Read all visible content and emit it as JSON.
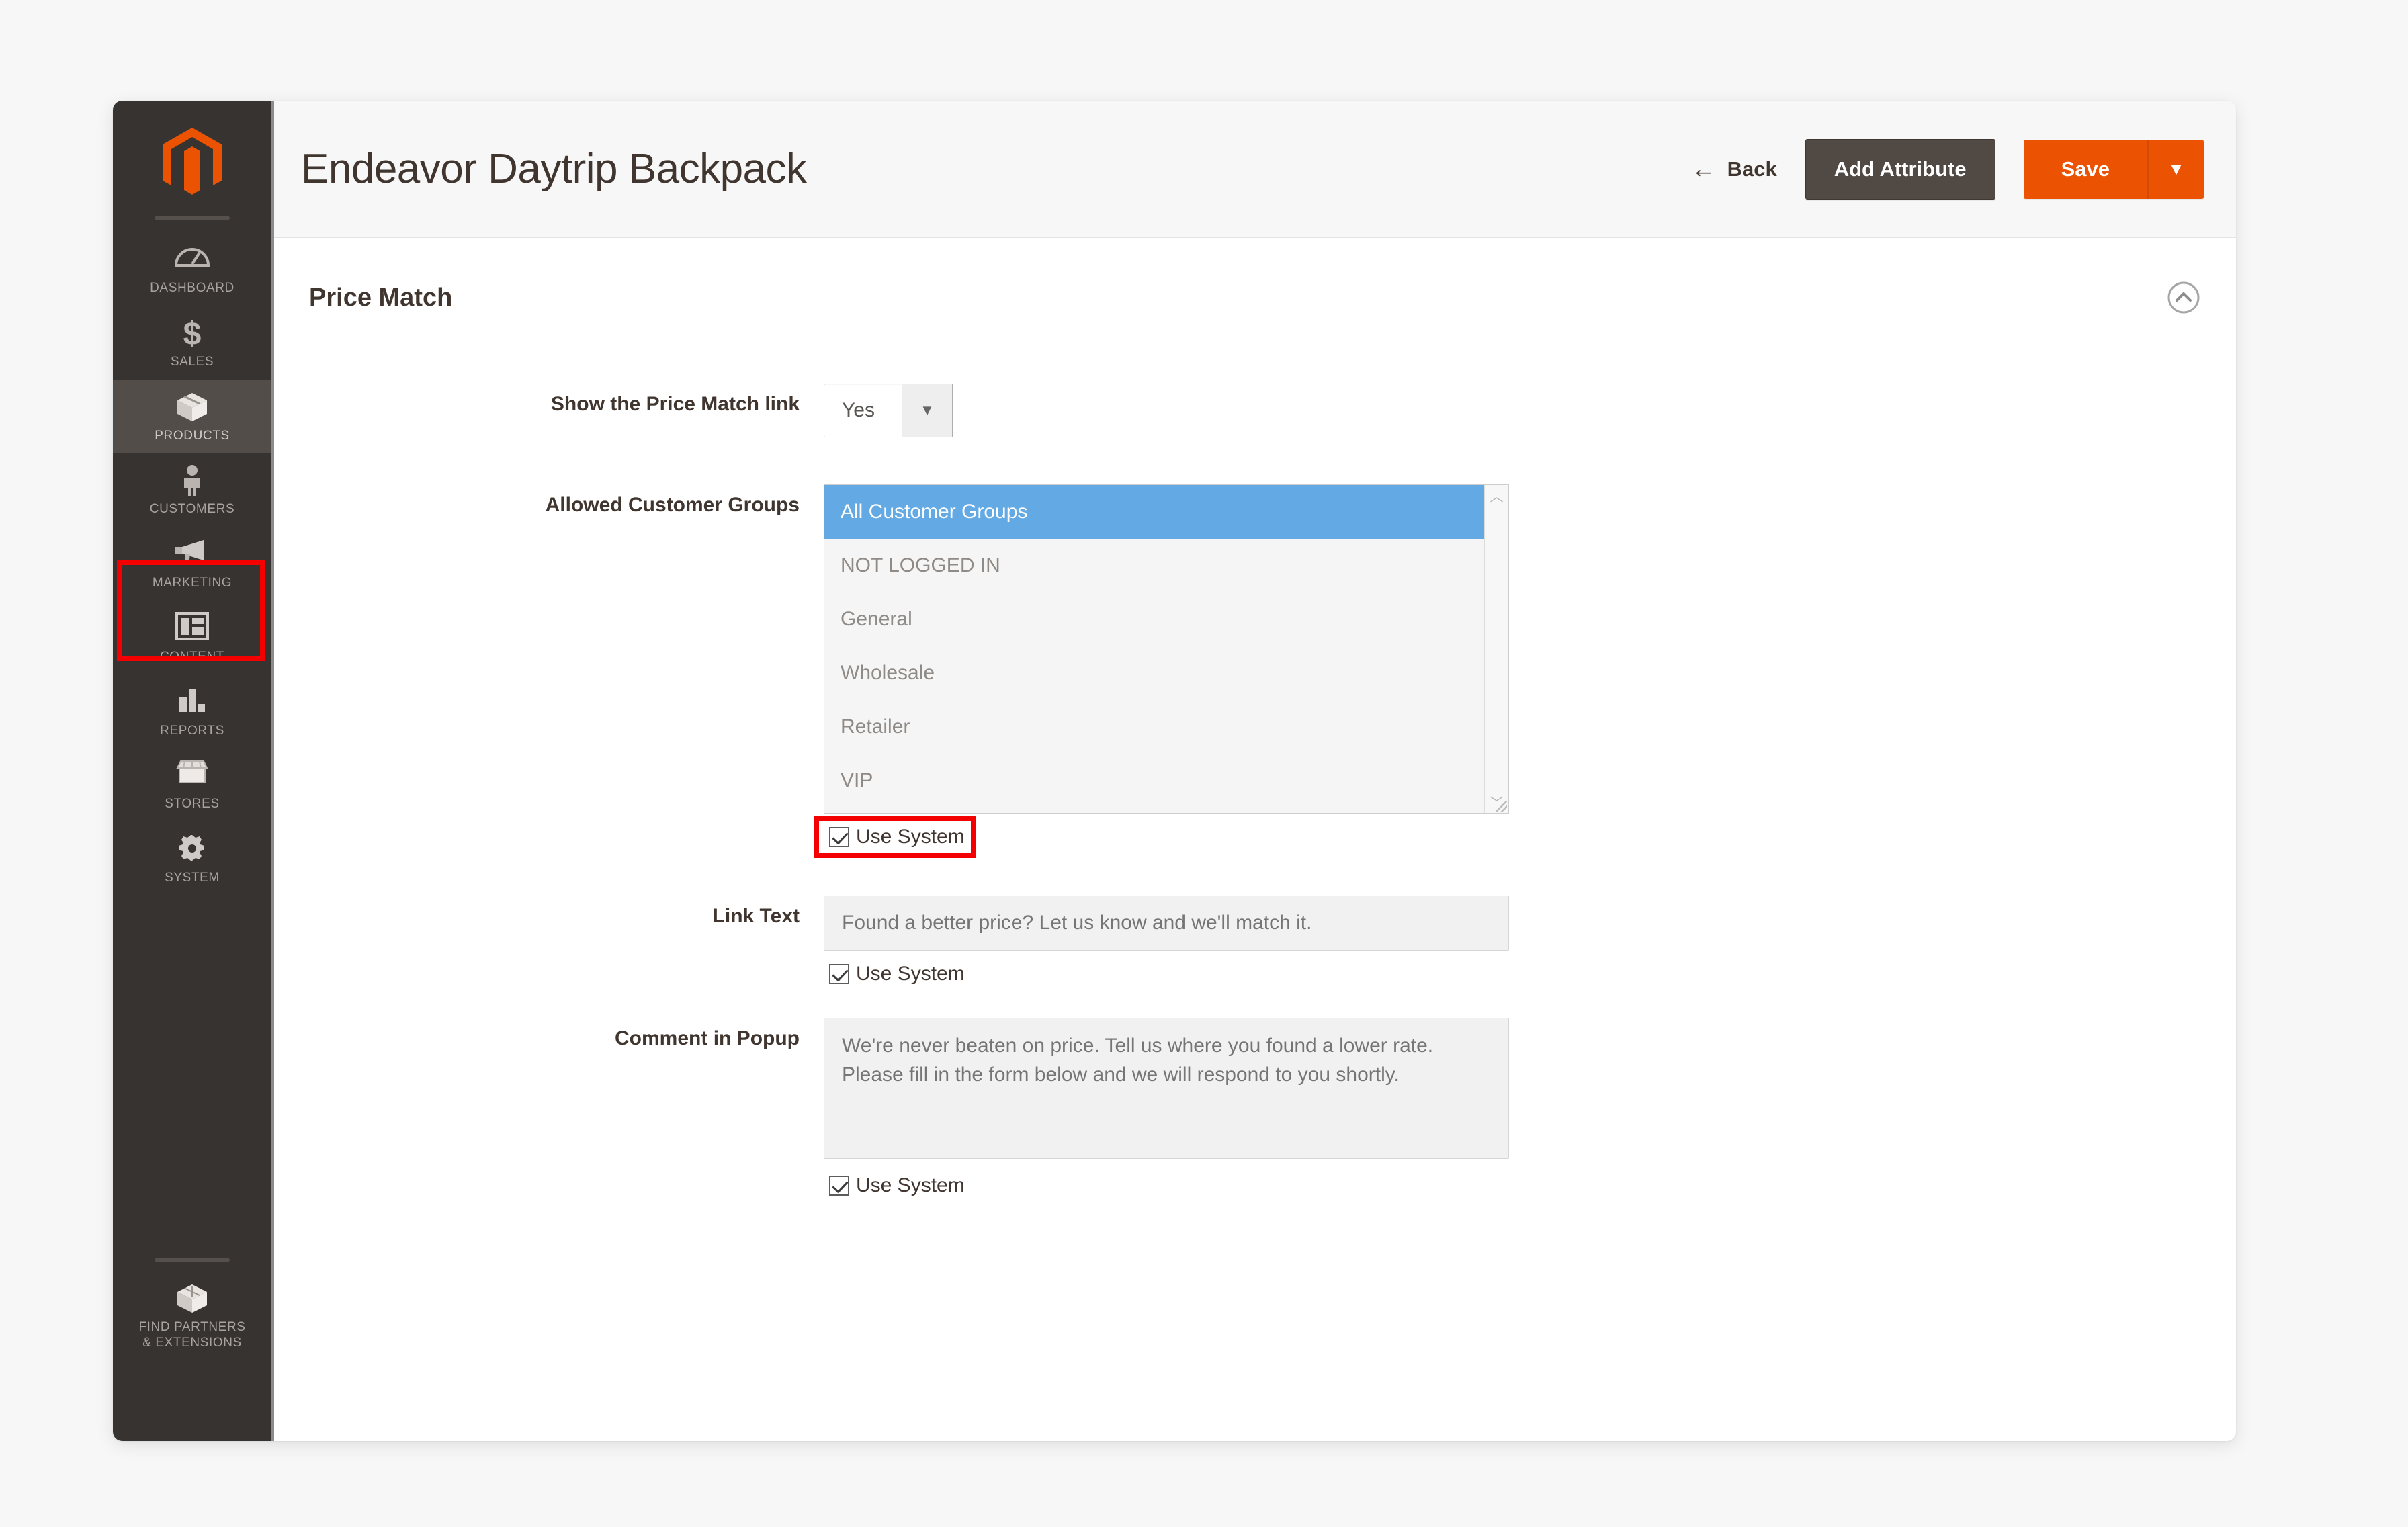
{
  "header": {
    "title": "Endeavor Daytrip Backpack",
    "back_label": "Back",
    "add_attribute_label": "Add Attribute",
    "save_label": "Save",
    "save_caret": "▼",
    "back_arrow": "←"
  },
  "sidebar": {
    "logo_name": "magento-logo",
    "items": [
      {
        "label": "DASHBOARD",
        "icon": "dashboard-icon",
        "active": false
      },
      {
        "label": "SALES",
        "icon": "dollar-icon",
        "active": false
      },
      {
        "label": "PRODUCTS",
        "icon": "box-icon",
        "active": true
      },
      {
        "label": "CUSTOMERS",
        "icon": "person-icon",
        "active": false
      },
      {
        "label": "MARKETING",
        "icon": "megaphone-icon",
        "active": false
      },
      {
        "label": "CONTENT",
        "icon": "layout-icon",
        "active": false
      },
      {
        "label": "REPORTS",
        "icon": "bar-chart-icon",
        "active": false
      },
      {
        "label": "STORES",
        "icon": "storefront-icon",
        "active": false
      },
      {
        "label": "SYSTEM",
        "icon": "gear-icon",
        "active": false
      }
    ],
    "bottom_item": {
      "label_line1": "FIND PARTNERS",
      "label_line2": "& EXTENSIONS",
      "icon": "cube-icon"
    }
  },
  "section": {
    "title": "Price Match",
    "collapse_icon": "chevron-up-circle-icon"
  },
  "fields": {
    "show_link": {
      "label": "Show the Price Match link",
      "value": "Yes",
      "caret": "▼"
    },
    "allowed_groups": {
      "label": "Allowed Customer Groups",
      "options": [
        {
          "label": "All Customer Groups",
          "selected": true
        },
        {
          "label": "NOT LOGGED IN",
          "selected": false
        },
        {
          "label": "General",
          "selected": false
        },
        {
          "label": "Wholesale",
          "selected": false
        },
        {
          "label": "Retailer",
          "selected": false
        },
        {
          "label": "VIP",
          "selected": false
        }
      ],
      "scroll_up": "︿",
      "scroll_down": "﹀",
      "use_system_label": "Use System",
      "use_system_checked": true,
      "annotated": true
    },
    "link_text": {
      "label": "Link Text",
      "placeholder": "Found a better price? Let us know and we'll match it.",
      "value": "",
      "use_system_label": "Use System",
      "use_system_checked": true
    },
    "comment_popup": {
      "label": "Comment in Popup",
      "placeholder": "We're never beaten on price. Tell us where you found a lower rate. Please fill in the form below and we will respond to you shortly.",
      "value": "",
      "use_system_label": "Use System",
      "use_system_checked": true
    }
  },
  "colors": {
    "accent_orange": "#eb5202",
    "sidebar_dark": "#373330",
    "selected_blue": "#63a9e4",
    "annotation_red": "#f40000"
  }
}
